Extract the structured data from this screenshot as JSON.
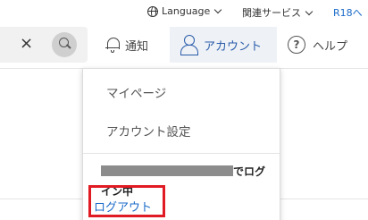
{
  "utility_bar": {
    "language_label": "Language",
    "related_services_label": "関連サービス",
    "r18_label": "R18へ"
  },
  "header": {
    "search": {
      "clear_symbol": "×"
    },
    "notifications_label": "通知",
    "account_label": "アカウント",
    "help_label": "ヘルプ",
    "help_symbol": "?"
  },
  "account_menu": {
    "items": [
      {
        "label": "マイページ"
      },
      {
        "label": "アカウント設定"
      }
    ],
    "login_status_suffix": "でログイン中",
    "logout_label": "ログアウト"
  },
  "colors": {
    "link": "#1a6ac9",
    "highlight_border": "#e11b24",
    "account_active_bg": "#eef1f6"
  }
}
